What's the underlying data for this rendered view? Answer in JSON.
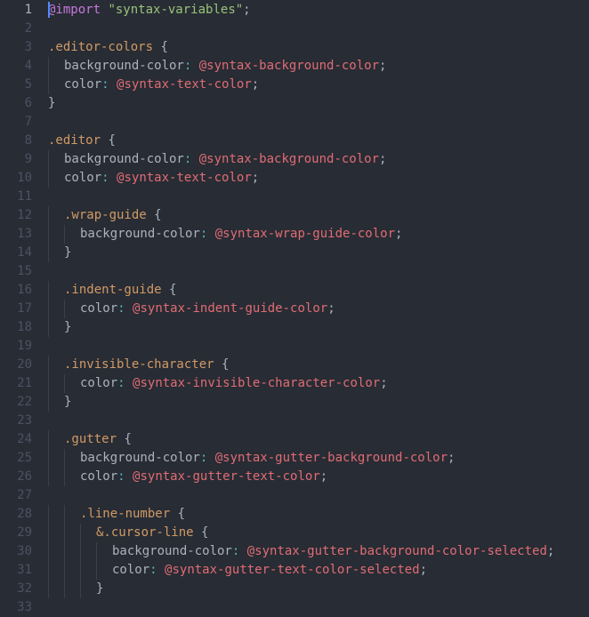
{
  "editor": {
    "language": "less",
    "cursor_line": 1,
    "lines": [
      {
        "n": 1,
        "indent": 0,
        "cursor": true,
        "tokens": [
          [
            "atrule",
            "@import"
          ],
          [
            "punct",
            " "
          ],
          [
            "string",
            "\"syntax-variables\""
          ],
          [
            "punct",
            ";"
          ]
        ]
      },
      {
        "n": 2,
        "indent": 0,
        "tokens": []
      },
      {
        "n": 3,
        "indent": 0,
        "tokens": [
          [
            "class",
            ".editor-colors"
          ],
          [
            "punct",
            " "
          ],
          [
            "brace",
            "{"
          ]
        ]
      },
      {
        "n": 4,
        "indent": 1,
        "tokens": [
          [
            "prop",
            "background-color"
          ],
          [
            "colon",
            ":"
          ],
          [
            "punct",
            " "
          ],
          [
            "var",
            "@syntax-background-color"
          ],
          [
            "punct",
            ";"
          ]
        ]
      },
      {
        "n": 5,
        "indent": 1,
        "tokens": [
          [
            "prop",
            "color"
          ],
          [
            "colon",
            ":"
          ],
          [
            "punct",
            " "
          ],
          [
            "var",
            "@syntax-text-color"
          ],
          [
            "punct",
            ";"
          ]
        ]
      },
      {
        "n": 6,
        "indent": 0,
        "tokens": [
          [
            "brace",
            "}"
          ]
        ]
      },
      {
        "n": 7,
        "indent": 0,
        "tokens": []
      },
      {
        "n": 8,
        "indent": 0,
        "tokens": [
          [
            "class",
            ".editor"
          ],
          [
            "punct",
            " "
          ],
          [
            "brace",
            "{"
          ]
        ]
      },
      {
        "n": 9,
        "indent": 1,
        "tokens": [
          [
            "prop",
            "background-color"
          ],
          [
            "colon",
            ":"
          ],
          [
            "punct",
            " "
          ],
          [
            "var",
            "@syntax-background-color"
          ],
          [
            "punct",
            ";"
          ]
        ]
      },
      {
        "n": 10,
        "indent": 1,
        "tokens": [
          [
            "prop",
            "color"
          ],
          [
            "colon",
            ":"
          ],
          [
            "punct",
            " "
          ],
          [
            "var",
            "@syntax-text-color"
          ],
          [
            "punct",
            ";"
          ]
        ]
      },
      {
        "n": 11,
        "indent": 0,
        "tokens": []
      },
      {
        "n": 12,
        "indent": 1,
        "tokens": [
          [
            "class",
            ".wrap-guide"
          ],
          [
            "punct",
            " "
          ],
          [
            "brace",
            "{"
          ]
        ]
      },
      {
        "n": 13,
        "indent": 2,
        "tokens": [
          [
            "prop",
            "background-color"
          ],
          [
            "colon",
            ":"
          ],
          [
            "punct",
            " "
          ],
          [
            "var",
            "@syntax-wrap-guide-color"
          ],
          [
            "punct",
            ";"
          ]
        ]
      },
      {
        "n": 14,
        "indent": 1,
        "tokens": [
          [
            "brace",
            "}"
          ]
        ]
      },
      {
        "n": 15,
        "indent": 0,
        "tokens": []
      },
      {
        "n": 16,
        "indent": 1,
        "tokens": [
          [
            "class",
            ".indent-guide"
          ],
          [
            "punct",
            " "
          ],
          [
            "brace",
            "{"
          ]
        ]
      },
      {
        "n": 17,
        "indent": 2,
        "tokens": [
          [
            "prop",
            "color"
          ],
          [
            "colon",
            ":"
          ],
          [
            "punct",
            " "
          ],
          [
            "var",
            "@syntax-indent-guide-color"
          ],
          [
            "punct",
            ";"
          ]
        ]
      },
      {
        "n": 18,
        "indent": 1,
        "tokens": [
          [
            "brace",
            "}"
          ]
        ]
      },
      {
        "n": 19,
        "indent": 0,
        "tokens": []
      },
      {
        "n": 20,
        "indent": 1,
        "tokens": [
          [
            "class",
            ".invisible-character"
          ],
          [
            "punct",
            " "
          ],
          [
            "brace",
            "{"
          ]
        ]
      },
      {
        "n": 21,
        "indent": 2,
        "tokens": [
          [
            "prop",
            "color"
          ],
          [
            "colon",
            ":"
          ],
          [
            "punct",
            " "
          ],
          [
            "var",
            "@syntax-invisible-character-color"
          ],
          [
            "punct",
            ";"
          ]
        ]
      },
      {
        "n": 22,
        "indent": 1,
        "tokens": [
          [
            "brace",
            "}"
          ]
        ]
      },
      {
        "n": 23,
        "indent": 0,
        "tokens": []
      },
      {
        "n": 24,
        "indent": 1,
        "tokens": [
          [
            "class",
            ".gutter"
          ],
          [
            "punct",
            " "
          ],
          [
            "brace",
            "{"
          ]
        ]
      },
      {
        "n": 25,
        "indent": 2,
        "tokens": [
          [
            "prop",
            "background-color"
          ],
          [
            "colon",
            ":"
          ],
          [
            "punct",
            " "
          ],
          [
            "var",
            "@syntax-gutter-background-color"
          ],
          [
            "punct",
            ";"
          ]
        ]
      },
      {
        "n": 26,
        "indent": 2,
        "tokens": [
          [
            "prop",
            "color"
          ],
          [
            "colon",
            ":"
          ],
          [
            "punct",
            " "
          ],
          [
            "var",
            "@syntax-gutter-text-color"
          ],
          [
            "punct",
            ";"
          ]
        ]
      },
      {
        "n": 27,
        "indent": 0,
        "tokens": []
      },
      {
        "n": 28,
        "indent": 2,
        "tokens": [
          [
            "class",
            ".line-number"
          ],
          [
            "punct",
            " "
          ],
          [
            "brace",
            "{"
          ]
        ]
      },
      {
        "n": 29,
        "indent": 3,
        "tokens": [
          [
            "class",
            "&.cursor-line"
          ],
          [
            "punct",
            " "
          ],
          [
            "brace",
            "{"
          ]
        ]
      },
      {
        "n": 30,
        "indent": 4,
        "tokens": [
          [
            "prop",
            "background-color"
          ],
          [
            "colon",
            ":"
          ],
          [
            "punct",
            " "
          ],
          [
            "var",
            "@syntax-gutter-background-color-selected"
          ],
          [
            "punct",
            ";"
          ]
        ]
      },
      {
        "n": 31,
        "indent": 4,
        "tokens": [
          [
            "prop",
            "color"
          ],
          [
            "colon",
            ":"
          ],
          [
            "punct",
            " "
          ],
          [
            "var",
            "@syntax-gutter-text-color-selected"
          ],
          [
            "punct",
            ";"
          ]
        ]
      },
      {
        "n": 32,
        "indent": 3,
        "tokens": [
          [
            "brace",
            "}"
          ]
        ]
      },
      {
        "n": 33,
        "indent": 0,
        "tokens": []
      }
    ]
  }
}
